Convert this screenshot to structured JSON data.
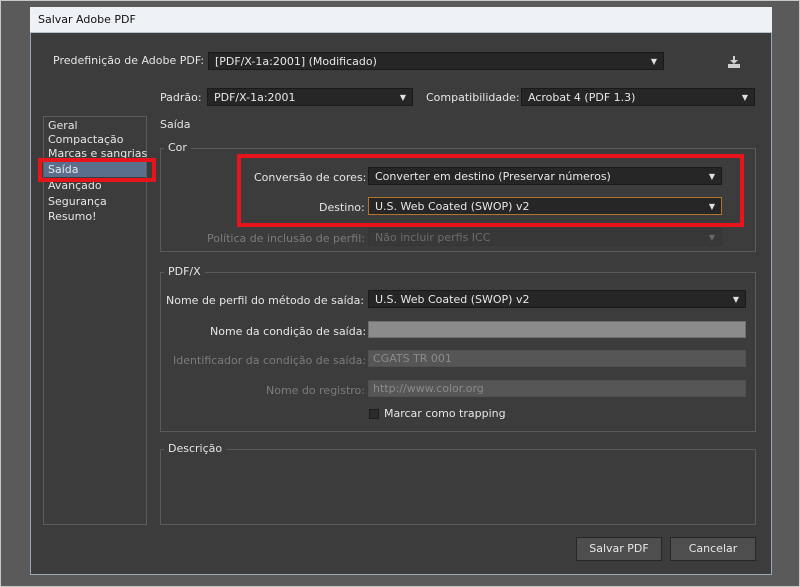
{
  "window": {
    "title": "Salvar Adobe PDF"
  },
  "preset": {
    "label": "Predefinição de Adobe PDF:",
    "value": "[PDF/X-1a:2001] (Modificado)",
    "save_icon": "save-preset-icon"
  },
  "standard": {
    "label": "Padrão:",
    "value": "PDF/X-1a:2001"
  },
  "compat": {
    "label": "Compatibilidade:",
    "value": "Acrobat 4 (PDF 1.3)"
  },
  "sidebar": {
    "items": [
      {
        "label": "Geral"
      },
      {
        "label": "Compactação"
      },
      {
        "label": "Marcas e sangrias"
      },
      {
        "label": "Saída"
      },
      {
        "label": "Avançado"
      },
      {
        "label": "Segurança"
      },
      {
        "label": "Resumo!"
      }
    ],
    "selected_index": 3
  },
  "section_title": "Saída",
  "color": {
    "group_title": "Cor",
    "conversion_label": "Conversão de cores:",
    "conversion_value": "Converter em destino (Preservar números)",
    "destination_label": "Destino:",
    "destination_value": "U.S. Web Coated (SWOP) v2",
    "profile_policy_label": "Política de inclusão de perfil:",
    "profile_policy_value": "Não incluir perfis ICC"
  },
  "pdfx": {
    "group_title": "PDF/X",
    "output_intent_label": "Nome de perfil do método de saída:",
    "output_intent_value": "U.S. Web Coated (SWOP) v2",
    "condition_name_label": "Nome da condição de saída:",
    "condition_name_value": "",
    "condition_id_label": "Identificador da condição de saída:",
    "condition_id_value": "CGATS TR 001",
    "registry_label": "Nome do registro:",
    "registry_value": "http://www.color.org",
    "trapping_label": "Marcar como trapping"
  },
  "description": {
    "group_title": "Descrição"
  },
  "buttons": {
    "save": "Salvar PDF",
    "cancel": "Cancelar"
  },
  "highlight_color": "#e8141b"
}
